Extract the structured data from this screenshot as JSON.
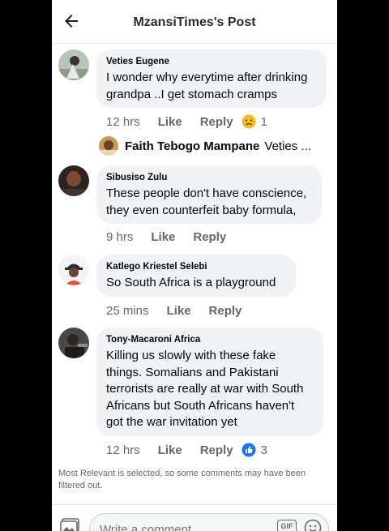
{
  "header": {
    "title": "MzansiTimes's Post"
  },
  "comments": [
    {
      "author": "Veties Eugene",
      "text": "I wonder why everytime after drinking grandpa ..I get stomach cramps",
      "time": "12 hrs",
      "like": "Like",
      "reply": "Reply",
      "reaction": "sad",
      "reaction_count": "1"
    },
    {
      "author": "Sibusiso Zulu",
      "text": "These people don't have conscience, they even counterfeit baby formula,",
      "time": "9 hrs",
      "like": "Like",
      "reply": "Reply"
    },
    {
      "author": "Katlego Kriestel Selebi",
      "text": "So South Africa is a playground",
      "time": "25 mins",
      "like": "Like",
      "reply": "Reply"
    },
    {
      "author": "Tony-Macaroni Africa",
      "text": "Killing us slowly with these fake things. Somalians and Pakistani terrorists are really at war with South Africans but South Africans haven't got the war invitation yet",
      "time": "12 hrs",
      "like": "Like",
      "reply": "Reply",
      "reaction": "like",
      "reaction_count": "3"
    }
  ],
  "reply_preview": {
    "name": "Faith Tebogo Mampane",
    "text": "Veties ..."
  },
  "filter_note": "Most Relevant is selected, so some comments may have been filtered out.",
  "composer": {
    "placeholder": "Write a comment...",
    "gif_label": "GIF"
  },
  "colors": {
    "bubble": "#f0f2f5",
    "meta_text": "#65676b",
    "like_blue": "#1877f2",
    "sad_yellow": "#f7b928"
  }
}
